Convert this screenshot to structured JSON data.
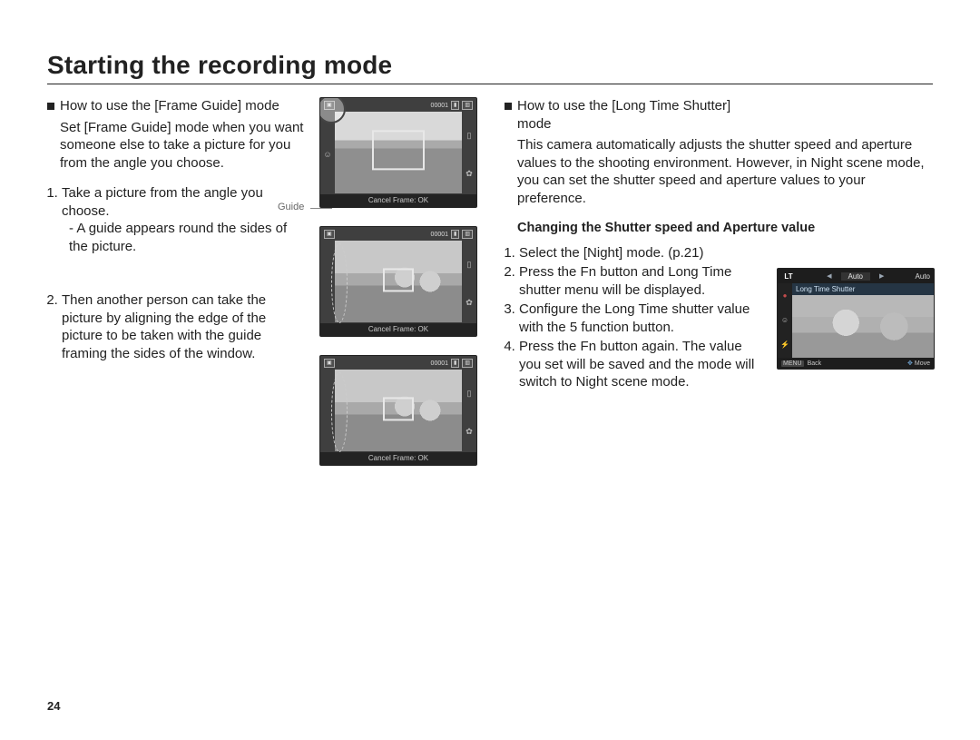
{
  "page": {
    "title": "Starting the recording mode",
    "page_number": "24"
  },
  "left": {
    "heading": "How to use the [Frame Guide] mode",
    "intro": "Set [Frame Guide] mode when you want someone else to take a picture for you from the angle you choose.",
    "step1": "Take a picture from the angle you choose.",
    "step1_sub": "A guide appears round the sides of the picture.",
    "guide_label": "Guide",
    "step2": "Then another person can take the picture by aligning the edge of the picture to be taken with the guide framing the sides of the window."
  },
  "lcd": {
    "counter": "00001",
    "cancel": "Cancel Frame: OK"
  },
  "right": {
    "heading": "How to use the [Long Time Shutter] mode",
    "intro": "This camera automatically adjusts the shutter speed and aperture values to the shooting environment. However, in Night scene mode, you can set the shutter speed and aperture values to your preference.",
    "subheading": "Changing the Shutter speed and Aperture value",
    "step1": "Select the [Night] mode. (p.21)",
    "step2": "Press the Fn button and Long Time shutter menu will be displayed.",
    "step3": "Configure the Long Time shutter value with the 5 function button.",
    "step4": "Press the Fn button again. The value you set will be saved and the mode will switch to Night scene mode."
  },
  "lt": {
    "label": "LT",
    "auto": "Auto",
    "menu": "Long Time Shutter",
    "back": "Back",
    "move": "Move",
    "menu_icon": "MENU"
  }
}
